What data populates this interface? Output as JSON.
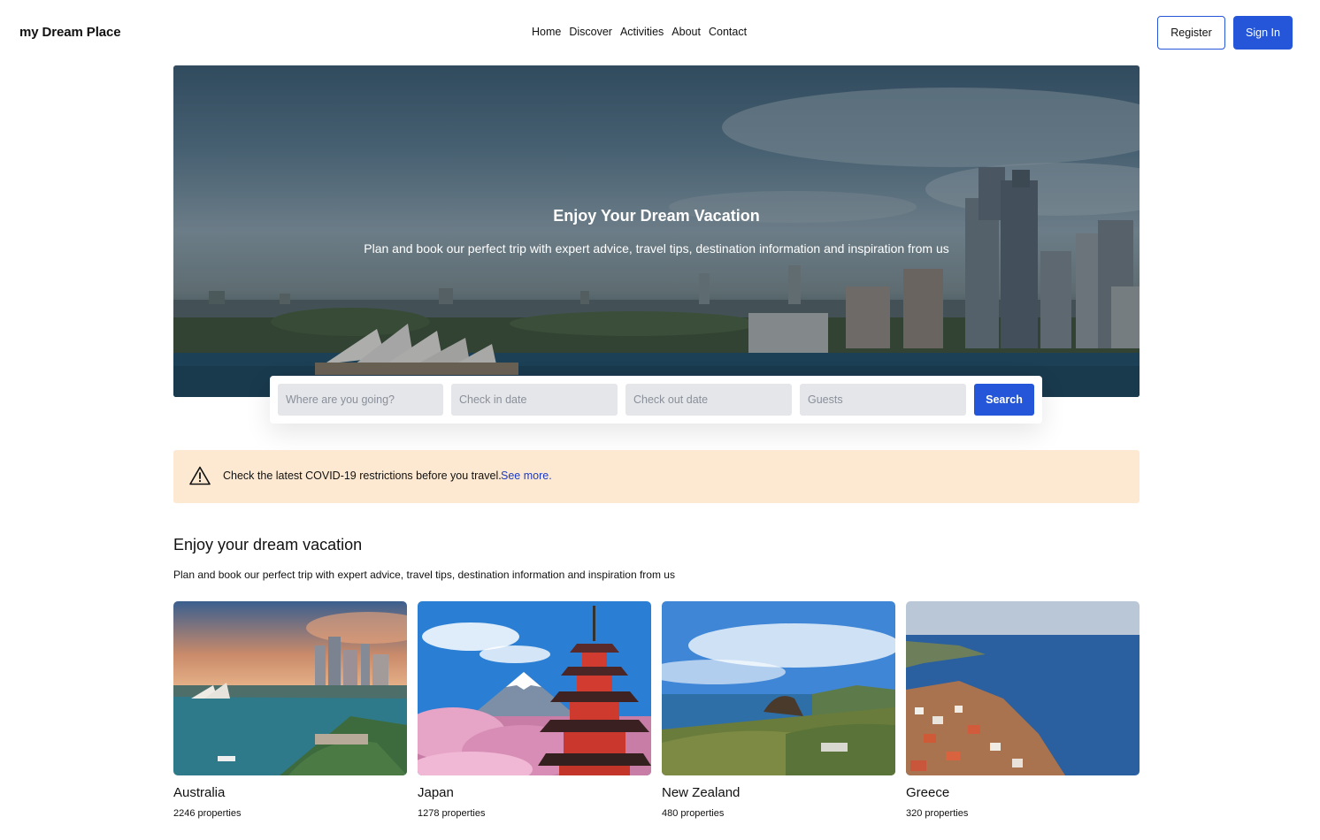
{
  "header": {
    "logo": "my Dream Place",
    "nav": [
      "Home",
      "Discover",
      "Activities",
      "About",
      "Contact"
    ],
    "register_label": "Register",
    "signin_label": "Sign In"
  },
  "hero": {
    "title": "Enjoy Your Dream Vacation",
    "subtitle": "Plan and book our perfect trip with expert advice, travel tips, destination information and inspiration from us"
  },
  "search": {
    "destination_placeholder": "Where are you going?",
    "checkin_placeholder": "Check in date",
    "checkout_placeholder": "Check out date",
    "guests_placeholder": "Guests",
    "button_label": "Search"
  },
  "alert": {
    "icon": "warning-icon",
    "text": "Check the latest COVID-19 restrictions before you travel.",
    "link": "See more."
  },
  "section": {
    "title": "Enjoy your dream vacation",
    "subtitle": "Plan and book our perfect trip with expert advice, travel tips, destination information and inspiration from us"
  },
  "destinations": [
    {
      "name": "Australia",
      "count": "2246 properties"
    },
    {
      "name": "Japan",
      "count": "1278 properties"
    },
    {
      "name": "New Zealand",
      "count": "480 properties"
    },
    {
      "name": "Greece",
      "count": "320 properties"
    }
  ],
  "colors": {
    "primary": "#2556d9",
    "alert_bg": "#fde9d1",
    "link": "#1d3bbf",
    "field_bg": "#e4e6ea"
  }
}
